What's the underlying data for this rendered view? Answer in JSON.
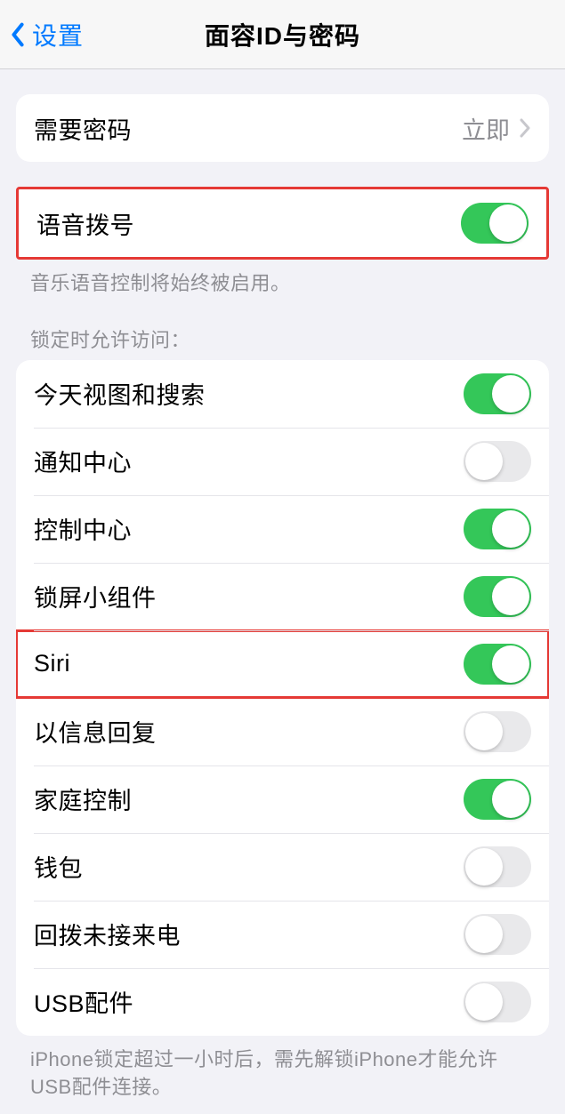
{
  "nav": {
    "back_label": "设置",
    "title": "面容ID与密码"
  },
  "require_passcode": {
    "label": "需要密码",
    "value": "立即"
  },
  "voice_dial": {
    "label": "语音拨号",
    "on": true,
    "footer": "音乐语音控制将始终被启用。"
  },
  "locked_access": {
    "header": "锁定时允许访问：",
    "items": [
      {
        "label": "今天视图和搜索",
        "on": true
      },
      {
        "label": "通知中心",
        "on": false
      },
      {
        "label": "控制中心",
        "on": true
      },
      {
        "label": "锁屏小组件",
        "on": true
      },
      {
        "label": "Siri",
        "on": true
      },
      {
        "label": "以信息回复",
        "on": false
      },
      {
        "label": "家庭控制",
        "on": true
      },
      {
        "label": "钱包",
        "on": false
      },
      {
        "label": "回拨未接来电",
        "on": false
      },
      {
        "label": "USB配件",
        "on": false
      }
    ],
    "footer": "iPhone锁定超过一小时后，需先解锁iPhone才能允许USB配件连接。"
  }
}
